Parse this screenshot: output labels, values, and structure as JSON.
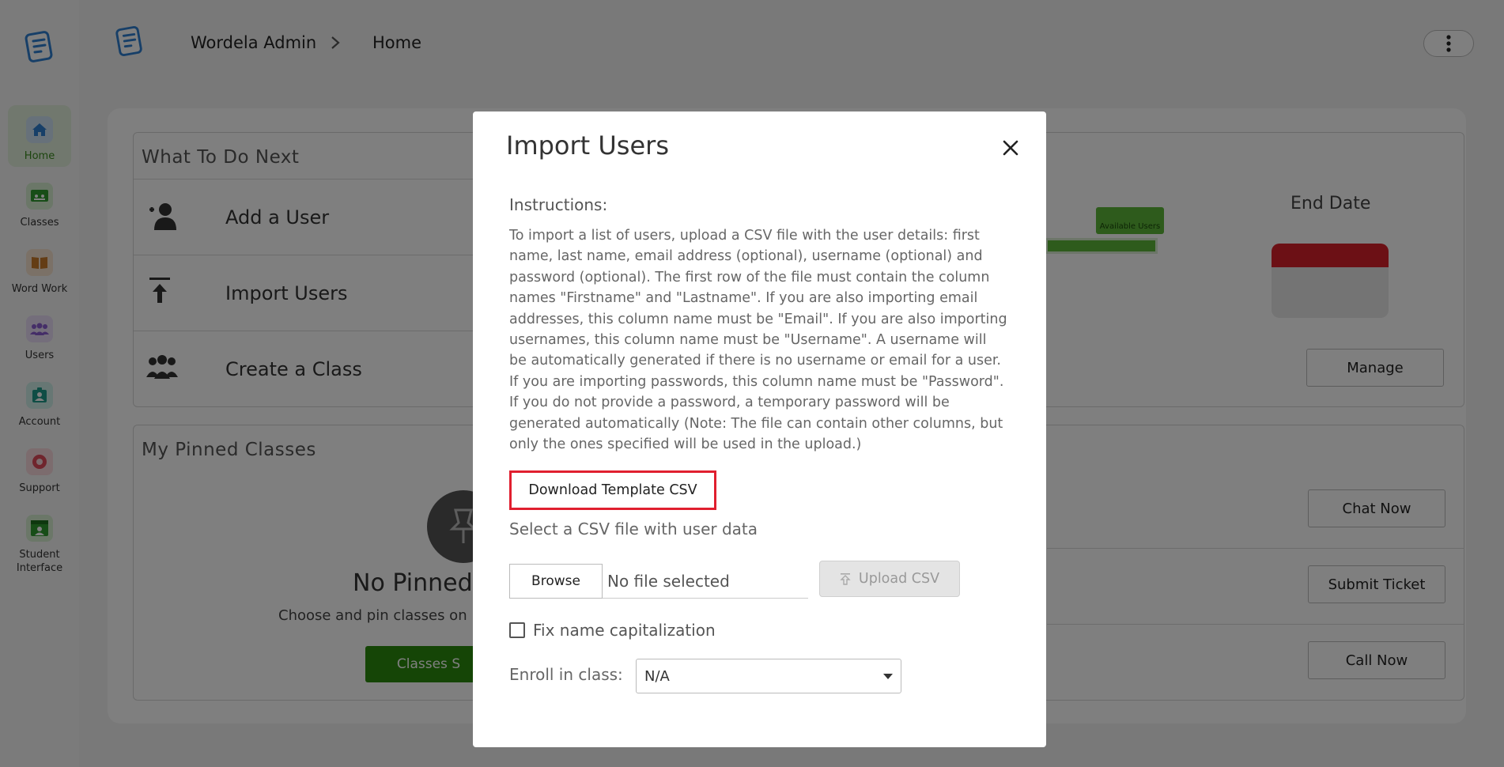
{
  "app": {
    "breadcrumb": {
      "root": "Wordela Admin",
      "current": "Home"
    }
  },
  "sidebar": {
    "items": [
      {
        "label": "Home",
        "icon": "home-icon"
      },
      {
        "label": "Classes",
        "icon": "classes-icon"
      },
      {
        "label": "Word Work",
        "icon": "book-icon"
      },
      {
        "label": "Users",
        "icon": "users-icon"
      },
      {
        "label": "Account",
        "icon": "account-icon"
      },
      {
        "label": "Support",
        "icon": "support-icon"
      },
      {
        "label": "Student Interface",
        "icon": "student-interface-icon"
      }
    ]
  },
  "background": {
    "todo": {
      "title": "What To Do Next",
      "items": [
        "Add a User",
        "Import Users",
        "Create a Class"
      ]
    },
    "pinned": {
      "title": "My Pinned Classes",
      "empty_title": "No Pinned",
      "empty_sub": "Choose and pin classes on",
      "button": "Classes S"
    },
    "end_date": "End Date",
    "available_users_tag": "Available Users",
    "manage": "Manage",
    "support_buttons": [
      "Chat Now",
      "Submit Ticket",
      "Call Now"
    ]
  },
  "modal": {
    "title": "Import Users",
    "instructions_heading": "Instructions:",
    "instructions_body": "To import a list of users, upload a CSV file with the user details: first name, last name, email address (optional), username (optional) and password (optional). The first row of the file must contain the column names \"Firstname\" and \"Lastname\". If you are also importing email addresses, this column name must be \"Email\". If you are also importing usernames, this column name must be \"Username\". A username will be automatically generated if there is no username or email for a user. If you are importing passwords, this column name must be \"Password\". If you do not provide a password, a temporary password will be generated automatically (Note: The file can contain other columns, but only the ones specified will be used in the upload.)",
    "download_template": "Download Template CSV",
    "select_label": "Select a CSV file with user data",
    "browse": "Browse",
    "file_status": "No file selected",
    "upload": "Upload CSV",
    "fix_caps_label": "Fix name capitalization",
    "fix_caps_checked": false,
    "enroll_label": "Enroll in class:",
    "enroll_value": "N/A"
  },
  "colors": {
    "brand_blue": "#2e7fd0",
    "accent_green": "#3a8a1e",
    "highlight_red": "#e01f2f"
  }
}
